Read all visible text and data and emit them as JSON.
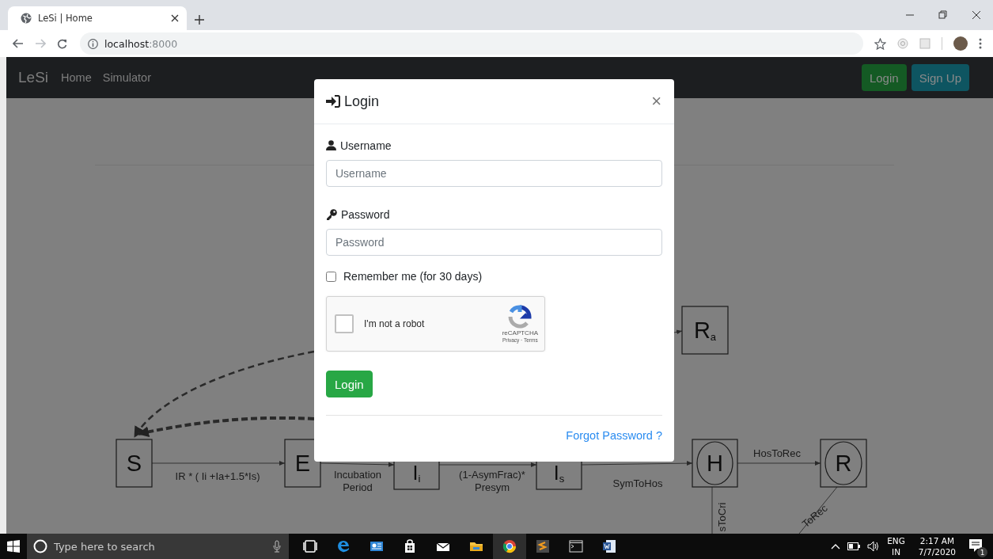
{
  "browser": {
    "tab_title": "LeSi | Home",
    "url_host": "localhost",
    "url_port": ":8000"
  },
  "navbar": {
    "brand": "LeSi",
    "links": [
      {
        "label": "Home"
      },
      {
        "label": "Simulator"
      }
    ],
    "buttons": [
      {
        "label": "Login",
        "kind": "success"
      },
      {
        "label": "Sign Up",
        "kind": "info"
      }
    ]
  },
  "diagram": {
    "nodes": [
      {
        "label": "S",
        "kind": "box"
      },
      {
        "label": "E",
        "kind": "box"
      },
      {
        "label": "I$_{i}$",
        "kind": "box"
      },
      {
        "label": "I$_{s}$",
        "kind": "box"
      },
      {
        "label": "H",
        "kind": "circled"
      },
      {
        "label": "R",
        "kind": "circled"
      },
      {
        "label": "R$_{a}$",
        "kind": "box"
      }
    ],
    "edge_labels": [
      "IR * ( Ii +Ia+1.5*Is)",
      "Incubation Period",
      "(1-AsymFrac)* Presym",
      "SymToHos",
      "HosToRec",
      "sToCri",
      "ToRec"
    ]
  },
  "modal": {
    "title": "Login",
    "close": "×",
    "fields": [
      {
        "label": "Username",
        "placeholder": "Username",
        "kind": "user"
      },
      {
        "label": "Password",
        "placeholder": "Password",
        "kind": "key"
      }
    ],
    "remember": {
      "label": "Remember me (for 30 days)",
      "checked": false
    },
    "captcha": {
      "label": "I'm not a robot",
      "checked": false,
      "brand": "reCAPTCHA",
      "links": "Privacy · Terms"
    },
    "submit": "Login",
    "forgot": "Forgot Password ?"
  },
  "taskbar": {
    "search_placeholder": "Type here to search",
    "language": "ENG",
    "region": "IN",
    "time": "2:17 AM",
    "date": "7/7/2020",
    "notifications": "1"
  }
}
